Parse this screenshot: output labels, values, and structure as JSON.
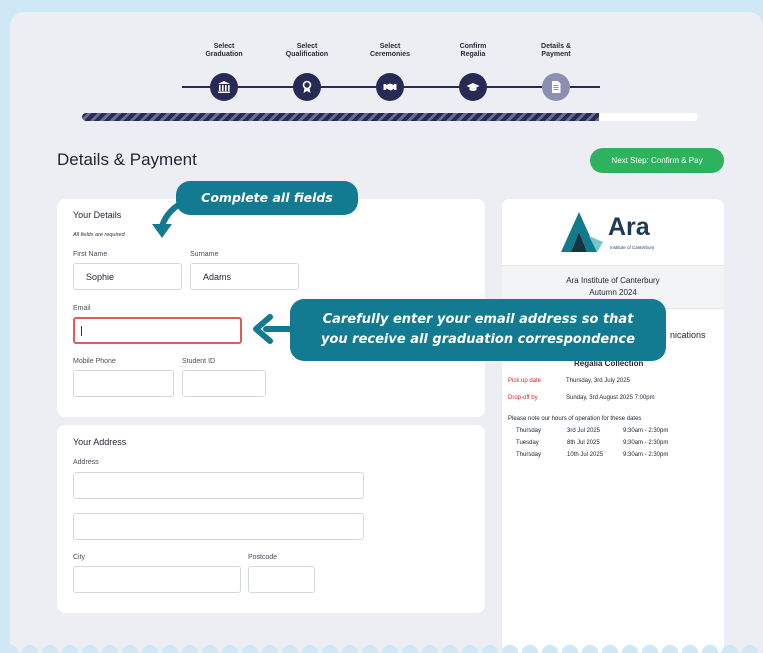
{
  "stepper": {
    "steps": [
      {
        "label_line1": "Select",
        "label_line2": "Graduation",
        "icon": "institution-icon"
      },
      {
        "label_line1": "Select",
        "label_line2": "Qualification",
        "icon": "award-ribbon-icon"
      },
      {
        "label_line1": "Select",
        "label_line2": "Ceremonies",
        "icon": "handshake-icon"
      },
      {
        "label_line1": "Confirm",
        "label_line2": "Regalia",
        "icon": "graduation-cap-icon"
      },
      {
        "label_line1": "Details &",
        "label_line2": "Payment",
        "icon": "document-icon"
      }
    ],
    "progress_fraction": 0.84
  },
  "page": {
    "title": "Details & Payment",
    "next_button": "Next Step: Confirm & Pay"
  },
  "details": {
    "title": "Your Details",
    "required_note": "All fields are required",
    "first_name_label": "First Name",
    "first_name_value": "Sophie",
    "surname_label": "Surname",
    "surname_value": "Adams",
    "email_label": "Email",
    "email_value": "",
    "mobile_label": "Mobile Phone",
    "student_id_label": "Student ID"
  },
  "address": {
    "title": "Your Address",
    "address_label": "Address",
    "city_label": "City",
    "postcode_label": "Postcode"
  },
  "summary": {
    "logo_text": "Ara",
    "logo_subtext": "Institute of Canterbury",
    "institution": "Ara Institute of Canterbury",
    "term": "Autumn 2024",
    "partial_heading": "nications",
    "regalia_heading": "Regalia Collection",
    "pickup_label": "Pick up date",
    "pickup_value": "Thursday, 3rd July 2025",
    "dropoff_label": "Drop-off by",
    "dropoff_value": "Sunday, 3rd August 2025 7:00pm",
    "hours_note": "Please note our hours of operation for these dates",
    "hours": [
      {
        "day": "Thursday",
        "date": "3rd Jul 2025",
        "time": "9:30am - 2:30pm"
      },
      {
        "day": "Tuesday",
        "date": "8th Jul 2025",
        "time": "9:30am - 2:30pm"
      },
      {
        "day": "Thursday",
        "date": "10th Jul 2025",
        "time": "9:30am - 2:30pm"
      }
    ]
  },
  "callouts": {
    "fields": "Complete all fields",
    "email_line1": "Carefully enter your email address so that",
    "email_line2": "you receive all graduation correspondence"
  },
  "colors": {
    "accent_navy": "#272a55",
    "button_green": "#2db35d",
    "callout_teal": "#137b91",
    "error_red": "#e25a5a"
  }
}
